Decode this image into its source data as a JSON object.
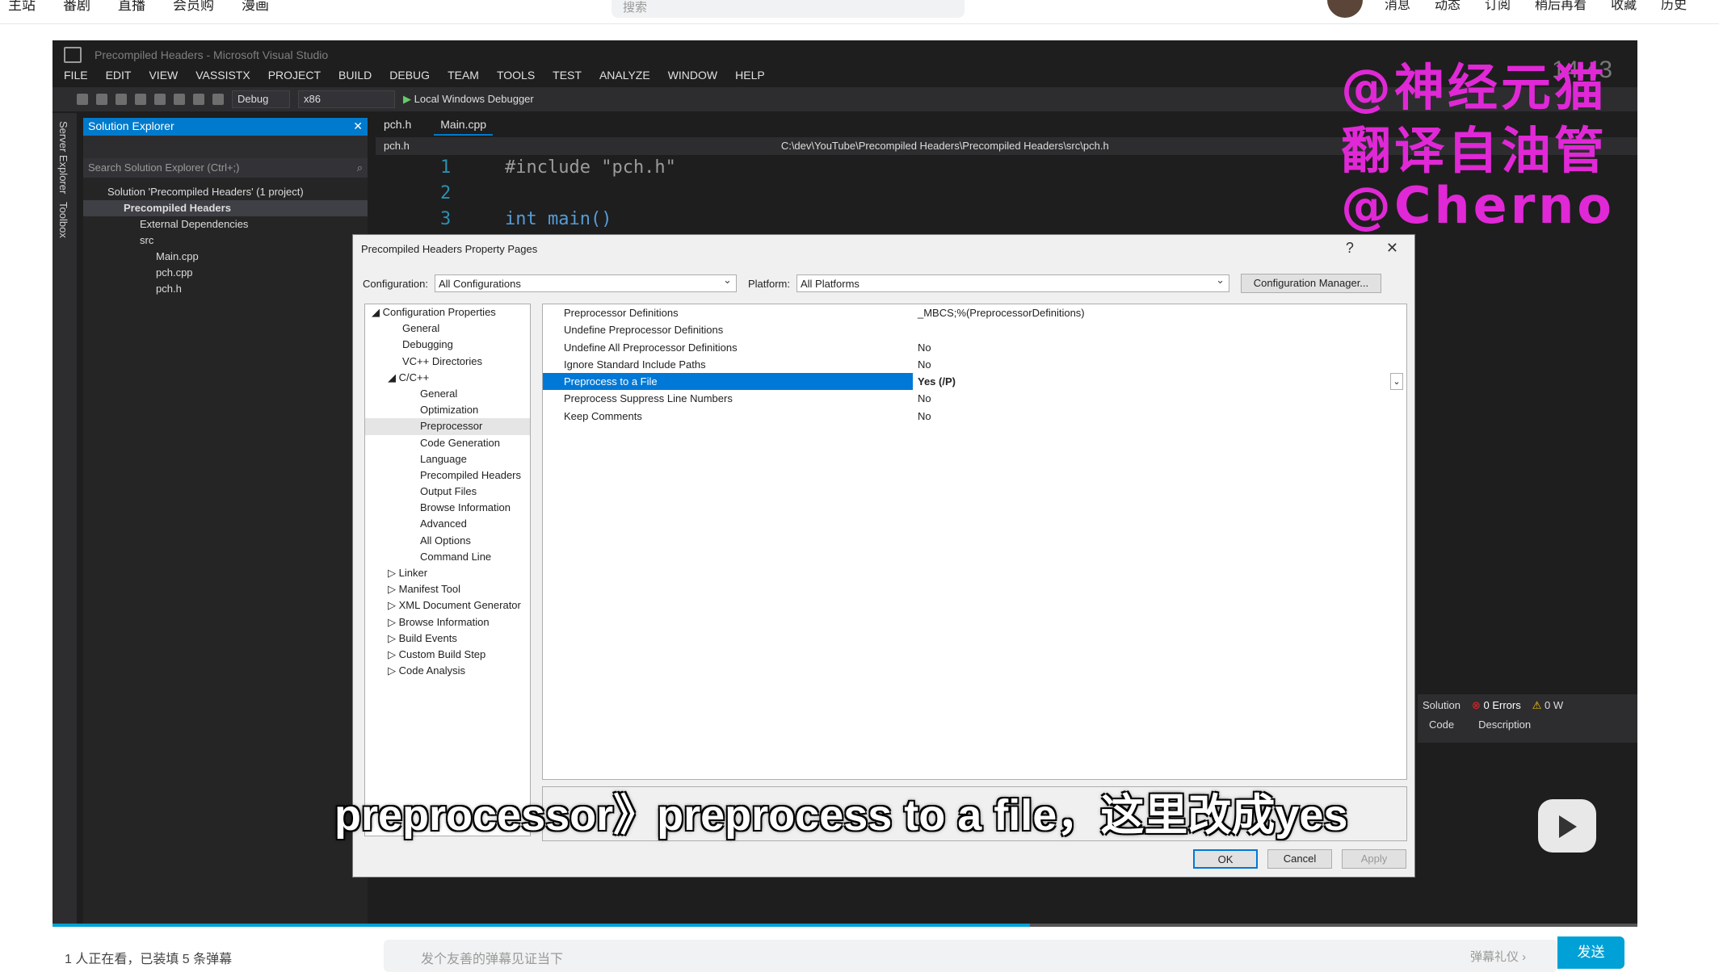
{
  "topbar": {
    "nav": [
      "主站",
      "番剧",
      "直播",
      "会员购",
      "漫画"
    ],
    "search_placeholder": "搜索",
    "right": [
      "消息",
      "动态",
      "订阅",
      "稍后再看",
      "收藏",
      "历史"
    ]
  },
  "vs": {
    "window_title": "Precompiled Headers - Microsoft Visual Studio",
    "menu": [
      "FILE",
      "EDIT",
      "VIEW",
      "VASSISTX",
      "PROJECT",
      "BUILD",
      "DEBUG",
      "TEAM",
      "TOOLS",
      "TEST",
      "ANALYZE",
      "WINDOW",
      "HELP"
    ],
    "toolbar": {
      "config": "Debug",
      "platform": "x86",
      "debugger": "Local Windows Debugger"
    },
    "vertical_tabs": [
      "Server Explorer",
      "Toolbox"
    ],
    "solution_explorer": {
      "title": "Solution Explorer",
      "search_placeholder": "Search Solution Explorer (Ctrl+;)",
      "items": [
        "Solution 'Precompiled Headers' (1 project)",
        "Precompiled Headers",
        "External Dependencies",
        "src",
        "Main.cpp",
        "pch.cpp",
        "pch.h"
      ]
    },
    "doc_tabs": [
      "pch.h",
      "Main.cpp"
    ],
    "nav_left": "pch.h",
    "nav_path": "C:\\dev\\YouTube\\Precompiled Headers\\Precompiled Headers\\src\\pch.h",
    "code_lines": [
      {
        "n": "1",
        "t": "#include \"pch.h\""
      },
      {
        "n": "2",
        "t": ""
      },
      {
        "n": "3",
        "t": "int main()"
      }
    ],
    "error_list": {
      "scope": "Solution",
      "errors": "0 Errors",
      "warnings": "0 W",
      "col_code": "Code",
      "col_desc": "Description"
    }
  },
  "watermark": [
    "@神经元猫",
    "翻译自油管",
    "@Cherno"
  ],
  "timer": "14:43",
  "dialog": {
    "title": "Precompiled Headers Property Pages",
    "help": "?",
    "close": "✕",
    "config_label": "Configuration:",
    "config_value": "All Configurations",
    "platform_label": "Platform:",
    "platform_value": "All Platforms",
    "config_manager": "Configuration Manager...",
    "tree": [
      "◢ Configuration Properties",
      "General",
      "Debugging",
      "VC++ Directories",
      "◢ C/C++",
      "General",
      "Optimization",
      "Preprocessor",
      "Code Generation",
      "Language",
      "Precompiled Headers",
      "Output Files",
      "Browse Information",
      "Advanced",
      "All Options",
      "Command Line",
      "▷ Linker",
      "▷ Manifest Tool",
      "▷ XML Document Generator",
      "▷ Browse Information",
      "▷ Build Events",
      "▷ Custom Build Step",
      "▷ Code Analysis"
    ],
    "properties": [
      {
        "k": "Preprocessor Definitions",
        "v": "_MBCS;%(PreprocessorDefinitions)"
      },
      {
        "k": "Undefine Preprocessor Definitions",
        "v": ""
      },
      {
        "k": "Undefine All Preprocessor Definitions",
        "v": "No"
      },
      {
        "k": "Ignore Standard Include Paths",
        "v": "No"
      },
      {
        "k": "Preprocess to a File",
        "v": "Yes (/P)"
      },
      {
        "k": "Preprocess Suppress Line Numbers",
        "v": "No"
      },
      {
        "k": "Keep Comments",
        "v": "No"
      }
    ],
    "ok": "OK",
    "cancel": "Cancel",
    "apply": "Apply"
  },
  "subtitle": "preprocessor》preprocess to a file，这里改成yes",
  "bottom": {
    "viewers": "1 人正在看，已装填 5 条弹幕",
    "danmaku_placeholder": "发个友善的弹幕见证当下",
    "etiquette": "弹幕礼仪 ›",
    "send": "发送"
  },
  "colors": {
    "accent": "#007acc",
    "selection": "#0078d7",
    "watermark": "#e028d6",
    "bili_blue": "#00a1d6"
  }
}
